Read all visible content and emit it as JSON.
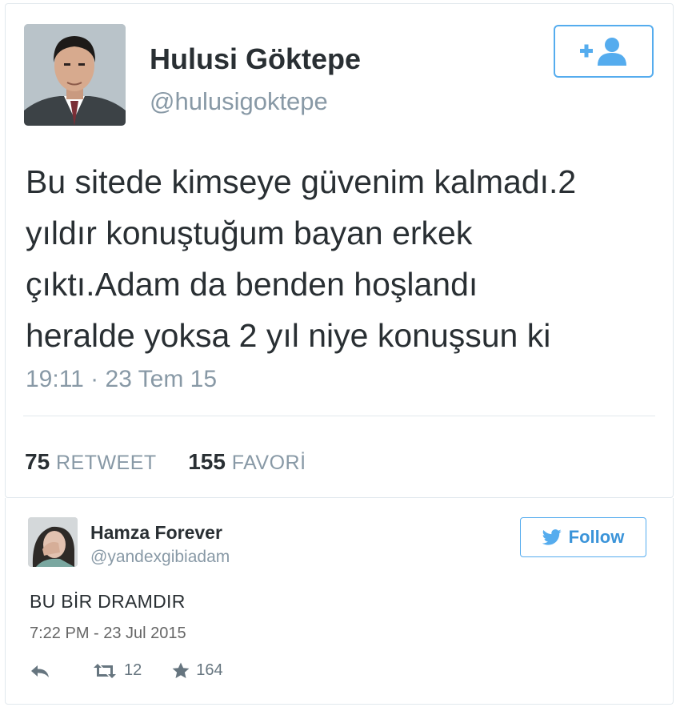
{
  "main_tweet": {
    "author_name": "Hulusi Göktepe",
    "author_handle": "@hulusigoktepe",
    "follow_icon": "add-user-icon",
    "text_lines": [
      "Bu sitede kimseye güvenim kalmadı.2",
      "yıldır konuştuğum bayan erkek",
      "çıktı.Adam da benden hoşlandı",
      "heralde yoksa 2 yıl niye konuşsun ki"
    ],
    "timestamp": "19:11 · 23 Tem 15",
    "retweet_count": "75",
    "retweet_label": "RETWEET",
    "favorite_count": "155",
    "favorite_label": "FAVORİ"
  },
  "reply_tweet": {
    "author_name": "Hamza Forever",
    "author_handle": "@yandexgibiadam",
    "follow_label": "Follow",
    "follow_icon": "twitter-bird-icon",
    "text": "BU BİR DRAMDIR",
    "timestamp": "7:22 PM - 23 Jul 2015",
    "retweet_count": "12",
    "favorite_count": "164",
    "action_icons": [
      "reply-icon",
      "retweet-icon",
      "star-icon"
    ]
  },
  "colors": {
    "accent": "#55acee",
    "text": "#292f33",
    "muted": "#8899a6",
    "border": "#e1e8ed"
  }
}
